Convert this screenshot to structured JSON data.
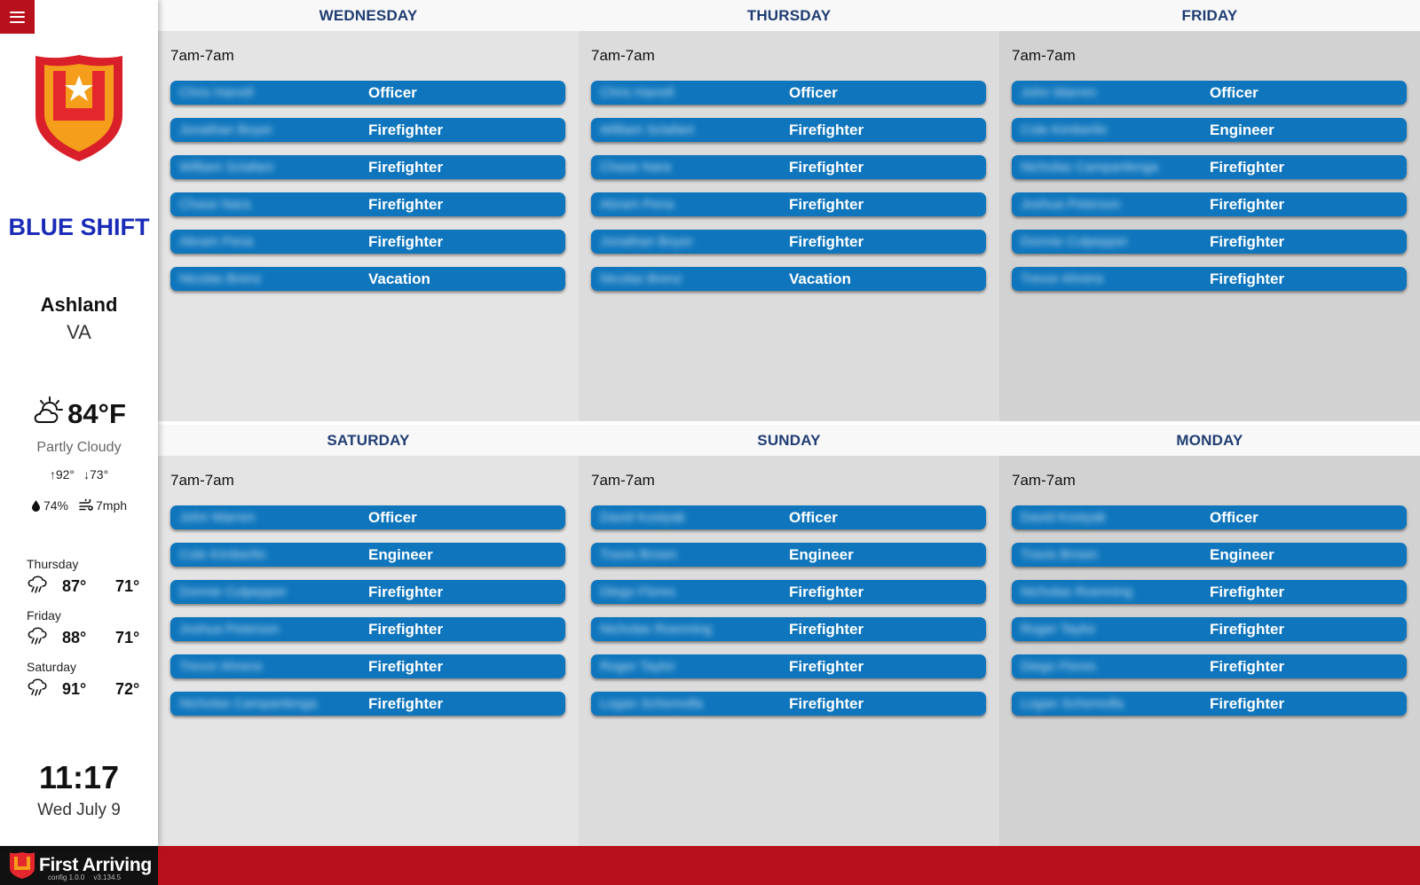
{
  "sidebar": {
    "shift_name": "BLUE SHIFT",
    "city": "Ashland",
    "state": "VA",
    "weather": {
      "icon": "partly-cloudy-icon",
      "temp": "84°F",
      "condition": "Partly Cloudy",
      "high": "92°",
      "low": "73°",
      "humidity": "74%",
      "wind": "7mph"
    },
    "forecast": [
      {
        "day": "Thursday",
        "icon": "storm-icon",
        "high": "87°",
        "low": "71°"
      },
      {
        "day": "Friday",
        "icon": "storm-icon",
        "high": "88°",
        "low": "71°"
      },
      {
        "day": "Saturday",
        "icon": "storm-icon",
        "high": "91°",
        "low": "72°"
      }
    ],
    "time": "11:17",
    "date": "Wed July 9"
  },
  "days": [
    {
      "name": "WEDNESDAY",
      "shift_time": "7am-7am",
      "rows": [
        {
          "name": "Chris Harrell",
          "role": "Officer"
        },
        {
          "name": "Jonathan Boyer",
          "role": "Firefighter"
        },
        {
          "name": "William Sclafani",
          "role": "Firefighter"
        },
        {
          "name": "Chase Nara",
          "role": "Firefighter"
        },
        {
          "name": "Abram Pena",
          "role": "Firefighter"
        },
        {
          "name": "Nicolas Brenz",
          "role": "Vacation"
        }
      ]
    },
    {
      "name": "THURSDAY",
      "shift_time": "7am-7am",
      "rows": [
        {
          "name": "Chris Harrell",
          "role": "Officer"
        },
        {
          "name": "William Sclafani",
          "role": "Firefighter"
        },
        {
          "name": "Chase Nara",
          "role": "Firefighter"
        },
        {
          "name": "Abram Pena",
          "role": "Firefighter"
        },
        {
          "name": "Jonathan Boyer",
          "role": "Firefighter"
        },
        {
          "name": "Nicolas Brenz",
          "role": "Vacation"
        }
      ]
    },
    {
      "name": "FRIDAY",
      "shift_time": "7am-7am",
      "rows": [
        {
          "name": "John Warren",
          "role": "Officer"
        },
        {
          "name": "Cole Kimberlin",
          "role": "Engineer"
        },
        {
          "name": "Nicholas Campanlenga",
          "role": "Firefighter"
        },
        {
          "name": "Joshua Peterson",
          "role": "Firefighter"
        },
        {
          "name": "Donnie Culpepper",
          "role": "Firefighter"
        },
        {
          "name": "Trevor Ahrens",
          "role": "Firefighter"
        }
      ]
    },
    {
      "name": "SATURDAY",
      "shift_time": "7am-7am",
      "rows": [
        {
          "name": "John Warren",
          "role": "Officer"
        },
        {
          "name": "Cole Kimberlin",
          "role": "Engineer"
        },
        {
          "name": "Donnie Culpepper",
          "role": "Firefighter"
        },
        {
          "name": "Joshua Peterson",
          "role": "Firefighter"
        },
        {
          "name": "Trevor Ahrens",
          "role": "Firefighter"
        },
        {
          "name": "Nicholas Campanlenga",
          "role": "Firefighter"
        }
      ]
    },
    {
      "name": "SUNDAY",
      "shift_time": "7am-7am",
      "rows": [
        {
          "name": "David Kostyak",
          "role": "Officer"
        },
        {
          "name": "Travis Brown",
          "role": "Engineer"
        },
        {
          "name": "Diego Flores",
          "role": "Firefighter"
        },
        {
          "name": "Nicholas Roenning",
          "role": "Firefighter"
        },
        {
          "name": "Roger Taylor",
          "role": "Firefighter"
        },
        {
          "name": "Logan Schemolla",
          "role": "Firefighter"
        }
      ]
    },
    {
      "name": "MONDAY",
      "shift_time": "7am-7am",
      "rows": [
        {
          "name": "David Kostyak",
          "role": "Officer"
        },
        {
          "name": "Travis Brown",
          "role": "Engineer"
        },
        {
          "name": "Nicholas Roenning",
          "role": "Firefighter"
        },
        {
          "name": "Roger Taylor",
          "role": "Firefighter"
        },
        {
          "name": "Diego Flores",
          "role": "Firefighter"
        },
        {
          "name": "Logan Schemolla",
          "role": "Firefighter"
        }
      ]
    }
  ],
  "footer": {
    "brand": "First Arriving",
    "config_version": "config 1.0.0",
    "app_version": "v3.134.5"
  },
  "colors": {
    "accent_red": "#b8111b",
    "row_blue": "#0f76bd",
    "shift_blue": "#1a2bb8",
    "header_text": "#1f3d72",
    "col_bg": [
      "#e4e4e4",
      "#dcdcdc",
      "#d2d2d2"
    ]
  }
}
